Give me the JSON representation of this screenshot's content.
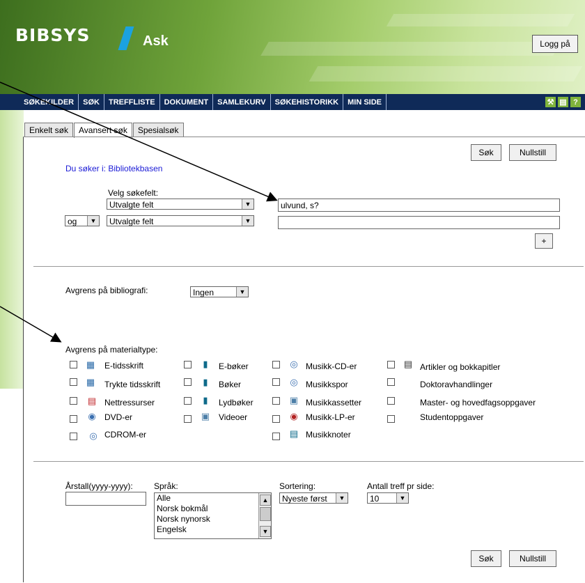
{
  "header": {
    "logo": "BIBSYS",
    "app_name": "Ask",
    "logout_label": "Logg på"
  },
  "nav": {
    "items": [
      "SØKEKILDER",
      "SØK",
      "TREFFLISTE",
      "DOKUMENT",
      "SAMLEKURV",
      "SØKEHISTORIKK",
      "MIN SIDE"
    ],
    "icons": [
      "tools-icon",
      "print-icon",
      "help-icon"
    ]
  },
  "tabs": [
    "Enkelt søk",
    "Avansert søk",
    "Spesialsøk"
  ],
  "search": {
    "search_button": "Søk",
    "reset_button": "Nullstill",
    "source_label": "Du søker i:",
    "source_value": "Bibliotekbasen",
    "field_label": "Velg søkefelt:",
    "field1": "Utvalgte felt",
    "field2": "Utvalgte felt",
    "operator": "og",
    "query1": "ulvund, s?",
    "query2": "",
    "add_row": "+"
  },
  "bibliography": {
    "label": "Avgrens på bibliografi:",
    "value": "Ingen"
  },
  "material": {
    "label": "Avgrens på materialtype:",
    "col1": [
      "E-tidsskrift",
      "Trykte tidsskrift",
      "Nettressurser",
      "DVD-er",
      "CDROM-er"
    ],
    "col2": [
      "E-bøker",
      "Bøker",
      "Lydbøker",
      "Videoer"
    ],
    "col3": [
      "Musikk-CD-er",
      "Musikkspor",
      "Musikkassetter",
      "Musikk-LP-er",
      "Musikknoter"
    ],
    "col4": [
      "Artikler og bokkapitler",
      "Doktoravhandlinger",
      "Master- og hovedfagsoppgaver",
      "Studentoppgaver"
    ]
  },
  "filters": {
    "year_label": "Årstall(yyyy-yyyy):",
    "year_value": "",
    "language_label": "Språk:",
    "languages": [
      "Alle",
      "Norsk bokmål",
      "Norsk nynorsk",
      "Engelsk"
    ],
    "sort_label": "Sortering:",
    "sort_value": "Nyeste først",
    "hits_label": "Antall treff pr side:",
    "hits_value": "10"
  }
}
